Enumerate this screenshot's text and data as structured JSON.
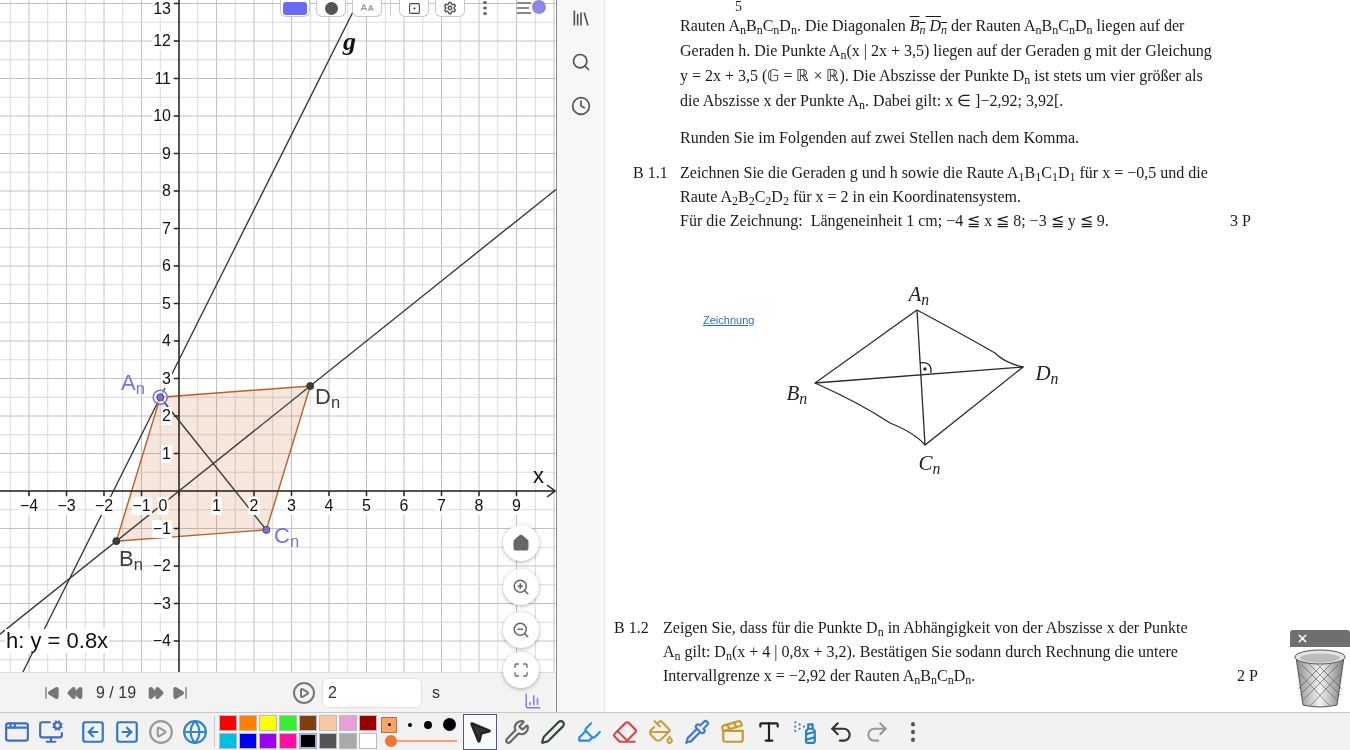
{
  "graphics_view": {
    "x_axis_label": "x",
    "x_tick_labels": [
      "−4",
      "−3",
      "−2",
      "−1",
      "0",
      "1",
      "2",
      "3",
      "4",
      "5",
      "6",
      "7",
      "8",
      "9"
    ],
    "y_tick_labels": [
      "13",
      "12",
      "11",
      "10",
      "9",
      "8",
      "7",
      "6",
      "5",
      "4",
      "3",
      "2",
      "1",
      "−1",
      "−2",
      "−3",
      "−4"
    ],
    "handwritten_label": "g",
    "line_equation": "h: y = 0.8x",
    "points": [
      {
        "label": "A$_{n}$",
        "color": "#7474dc",
        "selected": true
      },
      {
        "label": "B$_{n}$",
        "color": "#3c3c3c",
        "selected": false
      },
      {
        "label": "C$_{n}$",
        "color": "#7474dc",
        "selected": false
      },
      {
        "label": "D$_{n}$",
        "color": "#3c3c3c",
        "selected": false
      }
    ]
  },
  "animation_bar": {
    "step": "9 / 19",
    "speed": "2",
    "unit": "s"
  },
  "document": {
    "fraction_denominator": "5",
    "intro_lines": [
      [
        {
          "kind": "text",
          "text": "Rauten A$_{n}$B$_{n}$C$_{n}$D$_{n}$. Die Diagonalen "
        },
        {
          "kind": "segment",
          "text": "B$_{n}$ D$_{n}$"
        },
        {
          "kind": "text",
          "text": " der Rauten A$_{n}$B$_{n}$C$_{n}$D$_{n}$ liegen auf der"
        }
      ],
      [
        {
          "kind": "text",
          "text": "Geraden h. Die Punkte A$_{n}$(x | 2x + 3,5) liegen auf der Geraden g mit der Gleichung"
        }
      ],
      [
        {
          "kind": "text",
          "text": "y = 2x + 3,5 (𝔾 = ℝ × ℝ). Die Abszisse der Punkte D$_{n}$ ist stets um vier größer als"
        }
      ],
      [
        {
          "kind": "text",
          "text": "die Abszisse x der Punkte A$_{n}$. Dabei gilt: x ∈ ]−2,92; 3,92[."
        }
      ]
    ],
    "rounding_note": "Runden Sie im Folgenden auf zwei Stellen nach dem Komma.",
    "tasks": [
      {
        "number": "B 1.1",
        "lines": [
          "Zeichnen Sie die Geraden g und h sowie die Raute A$_{1}$B$_{1}$C$_{1}$D$_{1}$ für x = −0,5 und die",
          "Raute A$_{2}$B$_{2}$C$_{2}$D$_{2}$ für x = 2 in ein Koordinatensystem.",
          "Für die Zeichnung:  Längeneinheit 1 cm; −4 ≦ x ≦ 8; −3 ≦ y ≦ 9."
        ],
        "points": "3 P",
        "sketch": {
          "link": "Zeichnung",
          "labels": [
            "A$_{n}$",
            "B$_{n}$",
            "C$_{n}$",
            "D$_{n}$"
          ]
        }
      },
      {
        "number": "B 1.2",
        "lines": [
          "Zeigen Sie, dass für die Punkte D$_{n}$ in Abhängigkeit von der Abszisse x der Punkte",
          "A$_{n}$ gilt: D$_{n}$(x + 4 | 0,8x + 3,2). Bestätigen Sie sodann durch Rechnung die untere",
          "Intervallgrenze x = −2,92 der Rauten A$_{n}$B$_{n}$C$_{n}$D$_{n}$."
        ],
        "points": "2 P"
      }
    ]
  },
  "toolbar": {
    "app_buttons": [
      {
        "kind": "window"
      },
      {
        "kind": "settings"
      },
      {
        "kind": "previous-page"
      },
      {
        "kind": "next-page"
      },
      {
        "kind": "play"
      },
      {
        "kind": "browser"
      }
    ],
    "colors": [
      {
        "color": "#ff0000",
        "selected": false
      },
      {
        "color": "#ff8000",
        "selected": false
      },
      {
        "color": "#ffff00",
        "selected": false
      },
      {
        "color": "#33ee33",
        "selected": false
      },
      {
        "color": "#7a4010",
        "selected": false
      },
      {
        "color": "#f8c8a0",
        "selected": false
      },
      {
        "color": "#e8a0d8",
        "selected": false
      },
      {
        "color": "#990000",
        "selected": false
      },
      {
        "color": "#00c0e0",
        "selected": false
      },
      {
        "color": "#0000ee",
        "selected": false
      },
      {
        "color": "#9900ee",
        "selected": false
      },
      {
        "color": "#ff10a0",
        "selected": false
      },
      {
        "color": "#000000",
        "selected": true
      },
      {
        "color": "#555555",
        "selected": false
      },
      {
        "color": "#aaaaaa",
        "selected": false
      },
      {
        "color": "#ffffff",
        "selected": false
      }
    ],
    "pen_slider": {
      "level": 0
    },
    "tools": [
      {
        "kind": "pointer",
        "selected": true
      },
      {
        "kind": "tools",
        "selected": false
      },
      {
        "kind": "pen",
        "selected": false
      },
      {
        "kind": "highlighter",
        "selected": false
      },
      {
        "kind": "eraser",
        "selected": false
      },
      {
        "kind": "fill",
        "selected": false
      },
      {
        "kind": "pipette",
        "selected": false
      },
      {
        "kind": "media",
        "selected": false
      },
      {
        "kind": "text",
        "selected": false
      },
      {
        "kind": "spray",
        "selected": false
      },
      {
        "kind": "undo",
        "selected": false
      },
      {
        "kind": "redo",
        "selected": false
      },
      {
        "kind": "more",
        "selected": false
      }
    ]
  }
}
